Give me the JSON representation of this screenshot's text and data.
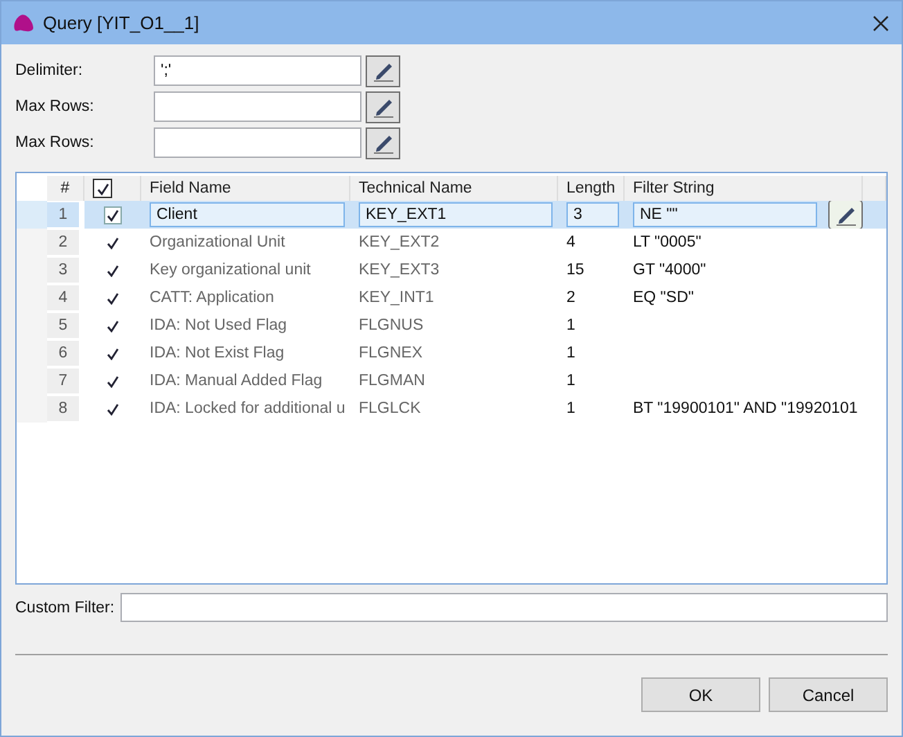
{
  "window": {
    "title": "Query [YIT_O1__1]"
  },
  "fields": [
    {
      "label": "Delimiter:",
      "value": "';'"
    },
    {
      "label": "Max Rows:"
    },
    {
      "label": "Max Rows:"
    }
  ],
  "table": {
    "columns": [
      "#",
      "Field Name",
      "Technical Name",
      "Length",
      "Filter String"
    ],
    "all_checked": true,
    "rows": [
      {
        "number": "1",
        "checked": true,
        "selected": true,
        "field_name": "Client",
        "technical_name": "KEY_EXT1",
        "length": "3",
        "filter": "NE \"\""
      },
      {
        "number": "2",
        "checked": true,
        "selected": false,
        "field_name": "Organizational Unit",
        "technical_name": "KEY_EXT2",
        "length": "4",
        "filter": "LT \"0005\""
      },
      {
        "number": "3",
        "checked": true,
        "selected": false,
        "field_name": "Key organizational unit",
        "technical_name": "KEY_EXT3",
        "length": "15",
        "filter": "GT \"4000\""
      },
      {
        "number": "4",
        "checked": true,
        "selected": false,
        "field_name": "CATT: Application",
        "technical_name": "KEY_INT1",
        "length": "2",
        "filter": "EQ \"SD\""
      },
      {
        "number": "5",
        "checked": true,
        "selected": false,
        "field_name": "IDA: Not Used Flag",
        "technical_name": "FLGNUS",
        "length": "1"
      },
      {
        "number": "6",
        "checked": true,
        "selected": false,
        "field_name": "IDA: Not Exist Flag",
        "technical_name": "FLGNEX",
        "length": "1"
      },
      {
        "number": "7",
        "checked": true,
        "selected": false,
        "field_name": "IDA: Manual Added Flag",
        "technical_name": "FLGMAN",
        "length": "1"
      },
      {
        "number": "8",
        "checked": true,
        "selected": false,
        "field_name": "IDA: Locked for additional u",
        "technical_name": "FLGLCK",
        "length": "1",
        "filter": " BT \"19900101\" AND  \"19920101"
      }
    ]
  },
  "custom_filter": {
    "label": "Custom Filter:"
  },
  "buttons": [
    "OK",
    "Cancel"
  ]
}
